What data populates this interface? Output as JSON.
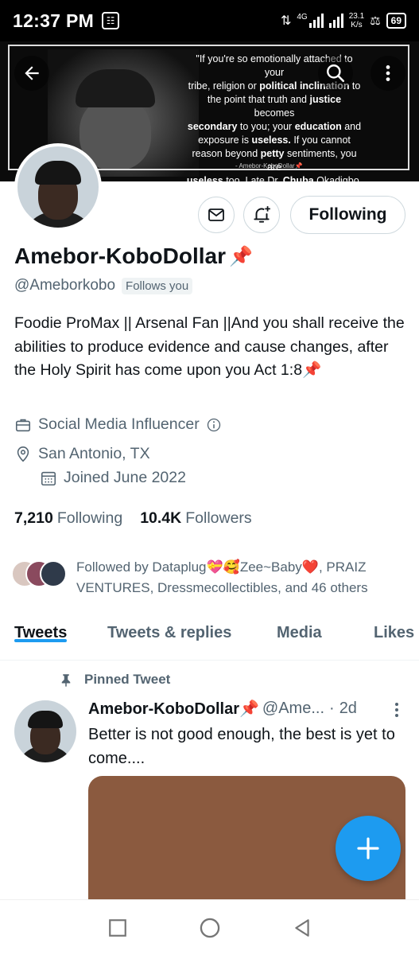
{
  "status_bar": {
    "time": "12:37 PM",
    "network": "4G",
    "speed_value": "23.1",
    "speed_unit": "K/s",
    "battery": "69"
  },
  "banner": {
    "quote_line1": "\"If you're so emotionally attached to your",
    "quote_line2a": "tribe, religion or ",
    "quote_line2b": "political inclination",
    "quote_line2c": " to",
    "quote_line3a": "the point that truth and ",
    "quote_line3b": "justice",
    "quote_line3c": " becomes",
    "quote_line4a": "secondary",
    "quote_line4b": " to you; your ",
    "quote_line4c": "education",
    "quote_line4d": " and",
    "quote_line5a": "exposure is ",
    "quote_line5b": "useless.",
    "quote_line5c": " If you cannot",
    "quote_line6a": "reason beyond ",
    "quote_line6b": "petty",
    "quote_line6c": " sentiments, you are",
    "quote_line7a": "useless",
    "quote_line7b": " too. Late Dr. ",
    "quote_line7c": "Chuba",
    "quote_line7d": " Okadigbo.",
    "signature": "- Amebor-KoboDollar📌"
  },
  "profile": {
    "name": "Amebor-KoboDollar",
    "name_emoji": "📌",
    "handle": "@Ameborkobo",
    "follows_you": "Follows you",
    "follow_button": "Following",
    "bio": "Foodie ProMax || Arsenal Fan ||And you shall receive the abilities to produce evidence and cause changes, after the Holy Spirit has come upon you Act 1:8📌",
    "category": "Social Media Influencer",
    "location": "San Antonio, TX",
    "joined": "Joined June 2022",
    "following_count": "7,210",
    "following_label": "Following",
    "followers_count": "10.4K",
    "followers_label": "Followers",
    "followed_by": "Followed by Dataplug💝🥰Zee~Baby❤️, PRAIZ VENTURES, Dressmecollectibles, and 46 others"
  },
  "tabs": [
    {
      "label": "Tweets",
      "active": true
    },
    {
      "label": "Tweets & replies",
      "active": false
    },
    {
      "label": "Media",
      "active": false
    },
    {
      "label": "Likes",
      "active": false
    }
  ],
  "pinned_tweet": {
    "pinned_label": "Pinned Tweet",
    "author": "Amebor-KoboDollar📌",
    "handle": "@Ame...",
    "separator": "·",
    "date": "2d",
    "text": "Better is not good enough, the best is yet to come...."
  },
  "colors": {
    "accent": "#1d9bf0",
    "text_primary": "#0f1419",
    "text_secondary": "#536471",
    "media_placeholder": "#8b5a3f"
  },
  "icons": {
    "back": "arrow-left-icon",
    "search": "search-icon",
    "more": "more-vertical-icon",
    "message": "envelope-icon",
    "notify": "bell-plus-icon",
    "category": "briefcase-icon",
    "location": "location-pin-icon",
    "joined": "calendar-icon",
    "pin": "pin-icon",
    "compose": "plus-icon"
  }
}
